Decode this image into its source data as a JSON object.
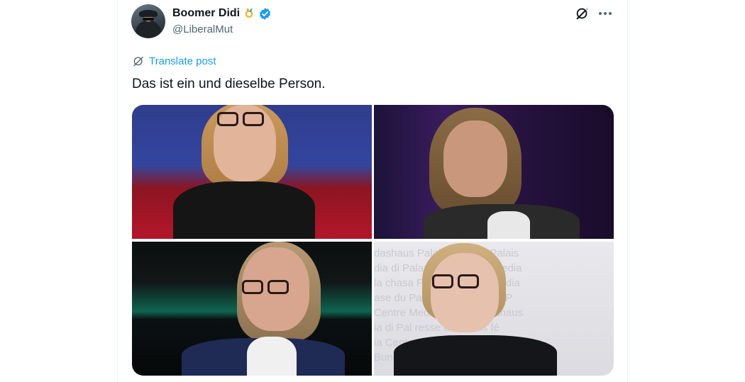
{
  "tweet": {
    "display_name": "Boomer Didi",
    "handle": "@LiberalMut",
    "affiliation_icon": "fire-badge-icon",
    "verified_icon": "verified-check-icon",
    "verified_color": "#1d9bf0",
    "grok_icon": "grok-icon",
    "more_icon": "more-options-icon",
    "translate_label": "Translate post",
    "text": "Das ist ein und dieselbe Person.",
    "media": [
      {
        "kind": "photo",
        "description_icon": "photo-woman-glasses-red-studio"
      },
      {
        "kind": "photo",
        "description_icon": "photo-woman-purple-studio"
      },
      {
        "kind": "photo",
        "description_icon": "photo-woman-glasses-dark-studio"
      },
      {
        "kind": "photo",
        "description_icon": "photo-woman-glasses-press-wall"
      }
    ],
    "press_wall_text": [
      "dashaus    Palais    uese du Palais",
      "dia di Palazzo    Center da media",
      "la chasa    Federal Palace Media",
      "ase du Pal    Centro media di P",
      "Centre    Media    zum Bundeshaus",
      "ia di Pal    resse du Palais fé",
      "ia Center    Centre    dia di Pal",
      "Bundeshaus    Media Center    P"
    ]
  },
  "colors": {
    "text_primary": "#0f1419",
    "text_secondary": "#536471",
    "link": "#1d9bf0"
  }
}
